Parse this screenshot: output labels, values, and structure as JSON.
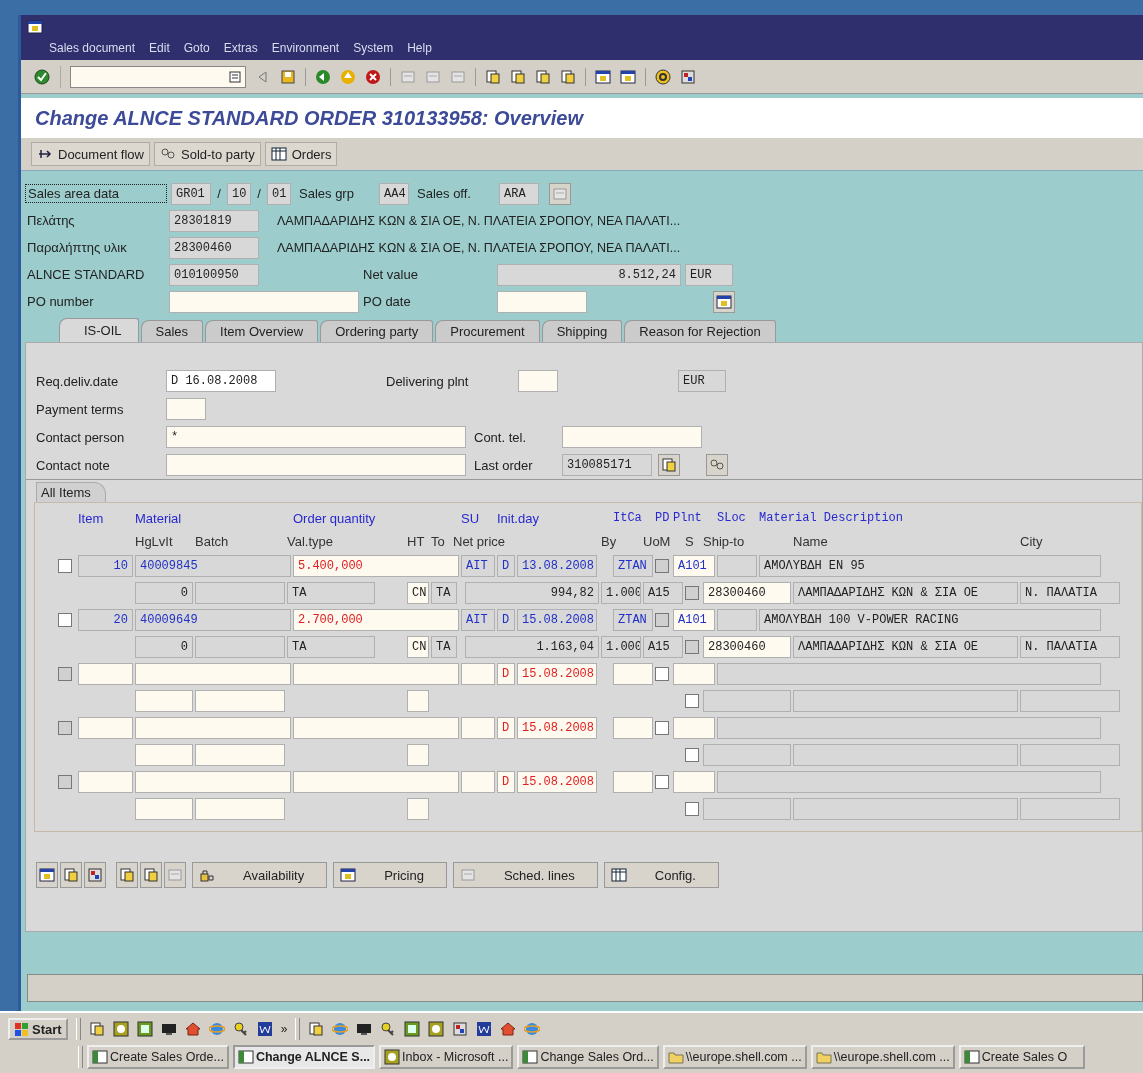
{
  "menu": [
    "Sales document",
    "Edit",
    "Goto",
    "Extras",
    "Environment",
    "System",
    "Help"
  ],
  "title": "Change ALNCE STANDARD ORDER 310133958: Overview",
  "app_toolbar": [
    {
      "label": "Document flow"
    },
    {
      "label": "Sold-to party"
    },
    {
      "label": "Orders"
    }
  ],
  "header": {
    "sales_area": {
      "label": "Sales area data",
      "sales_org": "GR01",
      "separators": [
        "/",
        "/"
      ],
      "distr_channel": "10",
      "division": "01",
      "sales_grp_label": "Sales grp",
      "sales_grp": "AA4",
      "sales_off_label": "Sales off.",
      "sales_off": "ARA"
    },
    "partners": [
      {
        "label": "Πελάτης",
        "number": "28301819",
        "address": "ΛΑΜΠΑΔΑΡΙΔΗΣ ΚΩΝ & ΣΙΑ ΟΕ, Ν. ΠΛΑΤΕΙΑ ΣΡΟΠΟΥ, ΝΕΑ ΠΑΛΑΤΙ..."
      },
      {
        "label": "Παραλήπτης υλικ",
        "number": "28300460",
        "address": "ΛΑΜΠΑΔΑΡΙΔΗΣ ΚΩΝ & ΣΙΑ ΟΕ, Ν. ΠΛΑΤΕΙΑ ΣΡΟΠΟΥ, ΝΕΑ ΠΑΛΑΤΙ..."
      }
    ],
    "order": {
      "label": "ALNCE STANDARD",
      "number": "010100950",
      "net_value_label": "Net value",
      "net_value": "8.512,24",
      "currency": "EUR"
    },
    "po": {
      "number_label": "PO number",
      "date_label": "PO date"
    }
  },
  "tabs": [
    {
      "label": "IS-OIL",
      "selected": true
    },
    {
      "label": "Sales",
      "selected": false
    },
    {
      "label": "Item Overview",
      "selected": false
    },
    {
      "label": "Ordering party",
      "selected": false
    },
    {
      "label": "Procurement",
      "selected": false
    },
    {
      "label": "Shipping",
      "selected": false
    },
    {
      "label": "Reason for Rejection",
      "selected": false
    }
  ],
  "fields": {
    "req_deliv_date_label": "Req.deliv.date",
    "req_deliv_date": "D 16.08.2008",
    "delivering_plant_label": "Delivering plnt",
    "currency": "EUR",
    "payment_terms_label": "Payment terms",
    "contact_person_label": "Contact person",
    "contact_person": "*",
    "contact_tel_label": "Cont. tel.",
    "contact_note_label": "Contact note",
    "last_order_label": "Last order",
    "last_order": "310085171"
  },
  "items_tab": "All Items",
  "columns_line_1": [
    "Item",
    "Material",
    "Order quantity",
    "SU",
    "Init.day",
    "ItCa",
    "PD",
    "Plnt",
    "SLoc",
    "Material Description"
  ],
  "columns_line_2": [
    "HgLvIt",
    "Batch",
    "Val.type",
    "HT",
    "To",
    "Net price",
    "By",
    "UoM",
    "S",
    "Ship-to",
    "Name",
    "City"
  ],
  "items": [
    {
      "kind": "item",
      "checked": false,
      "item": "10",
      "material": "40009845",
      "quantity": "5.400,000",
      "su": "AIT",
      "d": "D",
      "date": "13.08.2008",
      "itca": "ZTAN",
      "pd": false,
      "plnt": "A101",
      "description": "ΑΜΟΛΥΒΔΗ ΕΝ 95",
      "hglvit": "0",
      "val_type": "TA",
      "ht": "CN",
      "to": "TA",
      "net_price": "994,82",
      "by": "1.000",
      "uom": "A15",
      "s": false,
      "ship_to": "28300460",
      "name": "ΛΑΜΠΑΔΑΡΙΔΗΣ ΚΩΝ & ΣΙΑ ΟΕ",
      "city": "Ν. ΠΑΛΑΤΙΑ"
    },
    {
      "kind": "item",
      "checked": false,
      "item": "20",
      "material": "40009649",
      "quantity": "2.700,000",
      "su": "AIT",
      "d": "D",
      "date": "15.08.2008",
      "itca": "ZTAN",
      "pd": false,
      "plnt": "A101",
      "description": "ΑΜΟΛΥΒΔΗ 100 V-POWER RACING",
      "hglvit": "0",
      "val_type": "TA",
      "ht": "CN",
      "to": "TA",
      "net_price": "1.163,04",
      "by": "1.000",
      "uom": "A15",
      "s": false,
      "ship_to": "28300460",
      "name": "ΛΑΜΠΑΔΑΡΙΔΗΣ ΚΩΝ & ΣΙΑ ΟΕ",
      "city": "Ν. ΠΑΛΑΤΙΑ"
    },
    {
      "kind": "empty",
      "checked": false,
      "d": "D",
      "date": "15.08.2008",
      "pd": false,
      "s": false
    },
    {
      "kind": "empty",
      "checked": false,
      "d": "D",
      "date": "15.08.2008",
      "pd": false,
      "s": false
    },
    {
      "kind": "empty",
      "checked": false,
      "d": "D",
      "date": "15.08.2008",
      "pd": false,
      "s": false
    }
  ],
  "item_buttons": [
    {
      "label": "Availability"
    },
    {
      "label": "Pricing"
    },
    {
      "label": "Sched. lines"
    },
    {
      "label": "Config."
    }
  ],
  "taskbar": {
    "start": "Start",
    "quick_more": "»",
    "tasks": [
      {
        "label": "Create Sales Orde...",
        "selected": false
      },
      {
        "label": "Change ALNCE S...",
        "selected": true
      },
      {
        "label": "Inbox - Microsoft ...",
        "selected": false
      },
      {
        "label": "Change Sales Ord...",
        "selected": false
      },
      {
        "label": "\\\\europe.shell.com ...",
        "selected": false
      },
      {
        "label": "\\\\europe.shell.com ...",
        "selected": false
      },
      {
        "label": "Create Sales O",
        "selected": false
      }
    ]
  }
}
